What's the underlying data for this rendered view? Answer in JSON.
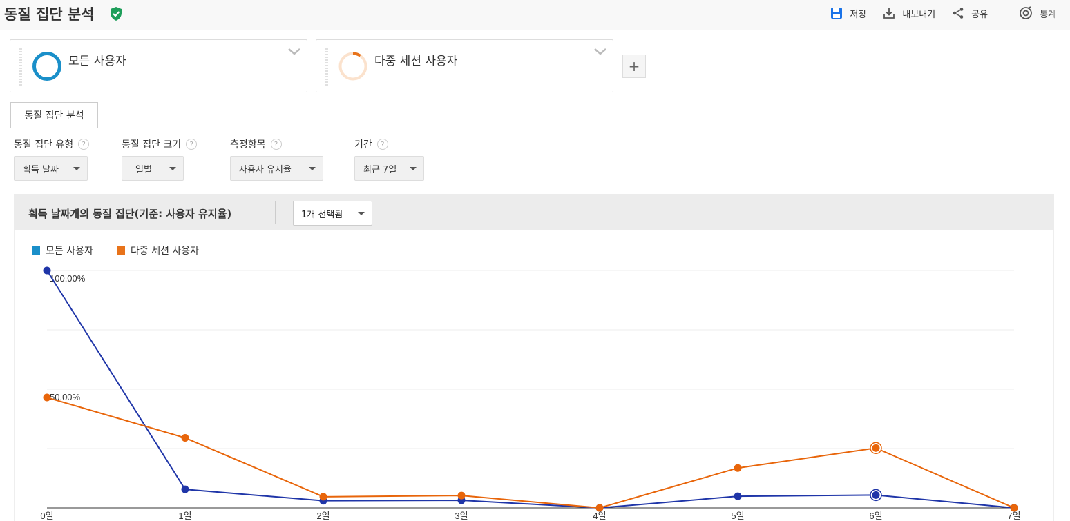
{
  "header": {
    "title": "동질 집단 분석",
    "actions": {
      "save": "저장",
      "export": "내보내기",
      "share": "공유",
      "stats": "통계"
    }
  },
  "segments": [
    {
      "label": "모든 사용자",
      "color": "#1a8fc9"
    },
    {
      "label": "다중 세션 사용자",
      "color": "#e8731a"
    }
  ],
  "add_segment_label": "+",
  "tab": {
    "label": "동질 집단 분석"
  },
  "controls": {
    "cohort_type": {
      "label": "동질 집단 유형",
      "value": "획득 날짜"
    },
    "cohort_size": {
      "label": "동질 집단 크기",
      "value": "일별"
    },
    "metric": {
      "label": "측정항목",
      "value": "사용자 유지율"
    },
    "date_range": {
      "label": "기간",
      "value": "최근 7일"
    },
    "help_glyph": "?"
  },
  "panel": {
    "title": "획득 날짜개의 동질 집단(기준: 사용자 유지율)",
    "selector": "1개 선택됨"
  },
  "chart_data": {
    "type": "line",
    "categories": [
      "0일",
      "1일",
      "2일",
      "3일",
      "4일",
      "5일",
      "6일",
      "7일"
    ],
    "y_tick_labels": [
      "100.00%",
      "50.00%"
    ],
    "ylim": [
      0,
      100
    ],
    "legend_position": "top-left",
    "grid": true,
    "series": [
      {
        "name": "모든 사용자",
        "color": "#1f35a8",
        "legend_color": "#1a8fc9",
        "values": [
          100,
          7.8,
          3.0,
          3.2,
          0,
          4.9,
          5.4,
          0
        ]
      },
      {
        "name": "다중 세션 사용자",
        "color": "#e8650a",
        "legend_color": "#e8731a",
        "values": [
          46.5,
          29.5,
          4.7,
          5.2,
          0,
          16.8,
          25.2,
          0
        ]
      }
    ],
    "highlighted_index": 6
  }
}
